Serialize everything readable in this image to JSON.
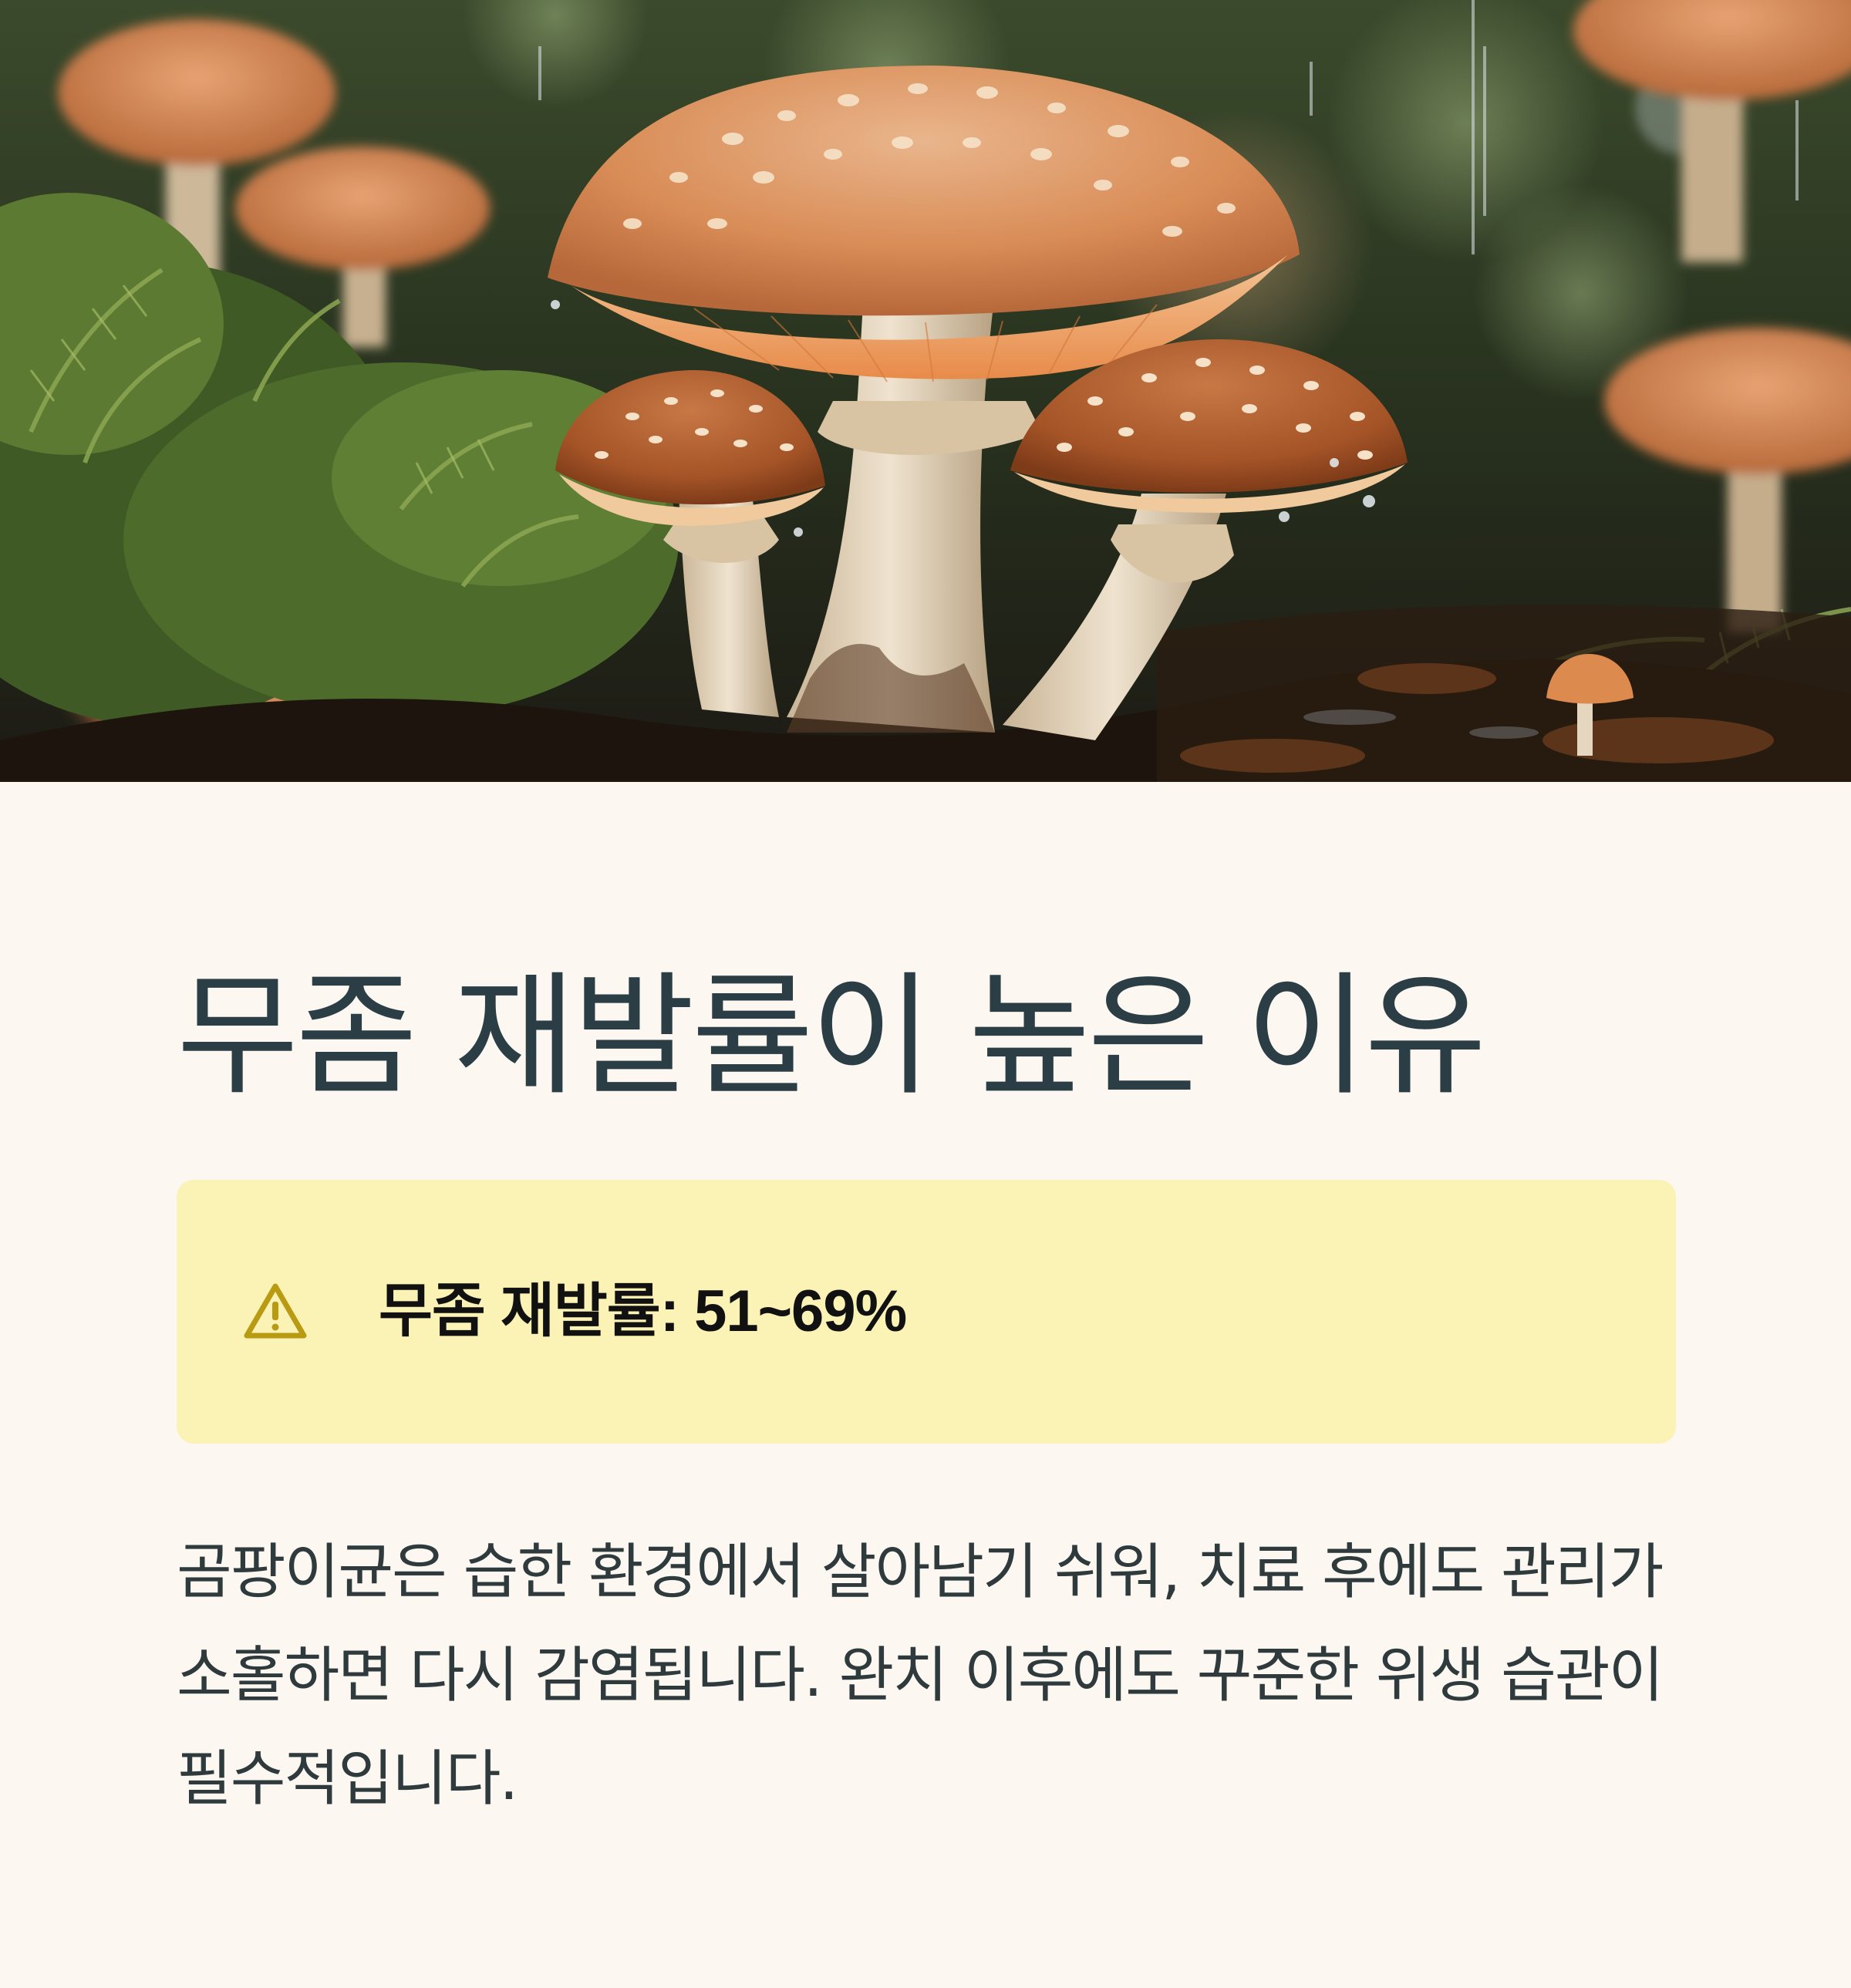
{
  "hero": {
    "image_icon": "mushrooms-photo"
  },
  "heading": {
    "title": "무좀 재발률이 높은 이유"
  },
  "callout": {
    "icon": "warning-triangle-icon",
    "text": "무좀 재발률: 51~69%",
    "colors": {
      "background": "#FBF2B5",
      "icon": "#B89B12"
    }
  },
  "body": {
    "paragraph": "곰팡이균은 습한 환경에서 살아남기 쉬워, 치료 후에도 관리가 소홀하면 다시 감염됩니다. 완치 이후에도 꾸준한 위생 습관이 필수적입니다."
  },
  "colors": {
    "page_background": "#FDF7F2",
    "title": "#2C3E45",
    "body_text": "#2F3A3D"
  }
}
